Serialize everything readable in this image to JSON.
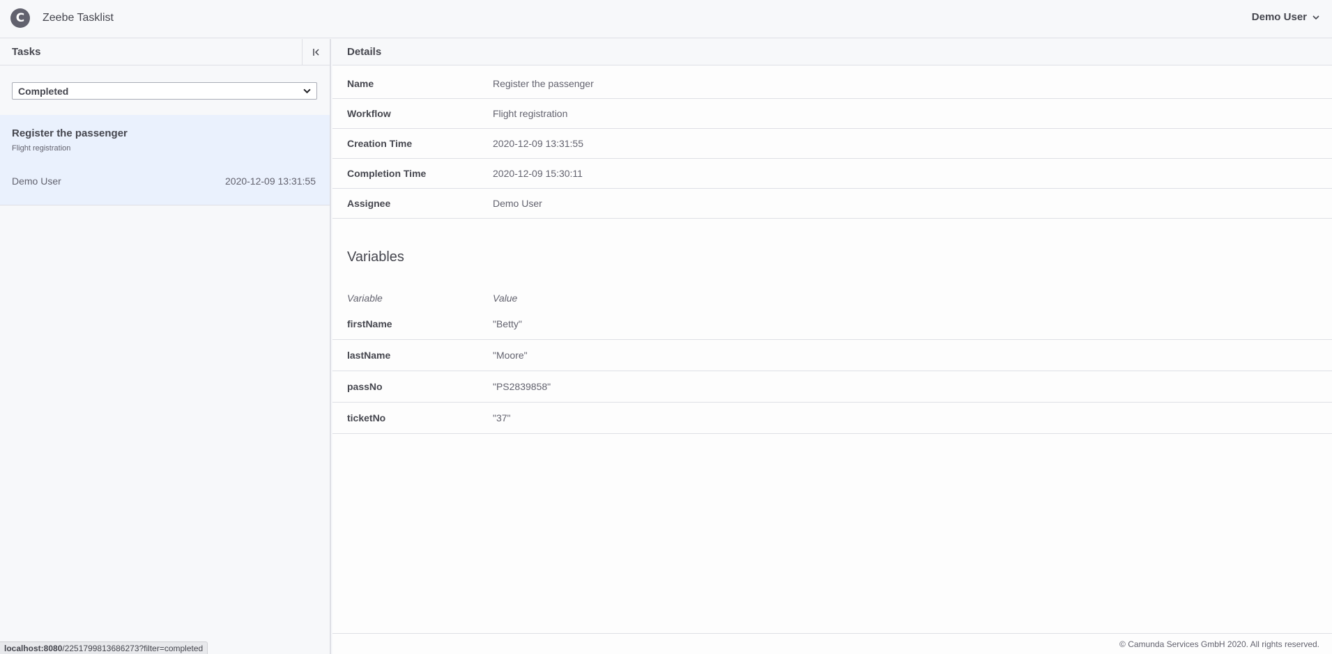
{
  "header": {
    "logo_glyph": "C",
    "app_title": "Zeebe Tasklist",
    "user_name": "Demo User"
  },
  "tasks_panel": {
    "title": "Tasks",
    "filter": {
      "selected": "Completed"
    },
    "task": {
      "name": "Register the passenger",
      "workflow": "Flight registration",
      "assignee": "Demo User",
      "created": "2020-12-09 13:31:55"
    }
  },
  "details_panel": {
    "title": "Details",
    "rows": [
      {
        "label": "Name",
        "value": "Register the passenger"
      },
      {
        "label": "Workflow",
        "value": "Flight registration"
      },
      {
        "label": "Creation Time",
        "value": "2020-12-09 13:31:55"
      },
      {
        "label": "Completion Time",
        "value": "2020-12-09 15:30:11"
      },
      {
        "label": "Assignee",
        "value": "Demo User"
      }
    ],
    "variables": {
      "title": "Variables",
      "col_variable": "Variable",
      "col_value": "Value",
      "rows": [
        {
          "name": "firstName",
          "value": "\"Betty\""
        },
        {
          "name": "lastName",
          "value": "\"Moore\""
        },
        {
          "name": "passNo",
          "value": "\"PS2839858\""
        },
        {
          "name": "ticketNo",
          "value": "\"37\""
        }
      ]
    },
    "footer": "© Camunda Services GmbH 2020. All rights reserved."
  },
  "status_bar": {
    "host": "localhost:8080",
    "path": "/2251799813686273?filter=completed"
  }
}
